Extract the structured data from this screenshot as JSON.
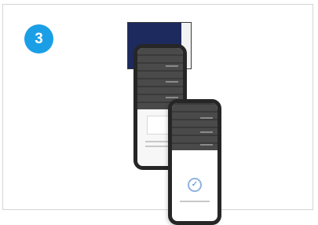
{
  "step": {
    "number": "3"
  },
  "illustration": {
    "back_phone": "phone-with-dark-list",
    "front_phone": "phone-with-success-check",
    "colors": {
      "badge": "#1a9fe6",
      "panel": "#1d2a5e",
      "check": "#3e7fd1"
    }
  }
}
